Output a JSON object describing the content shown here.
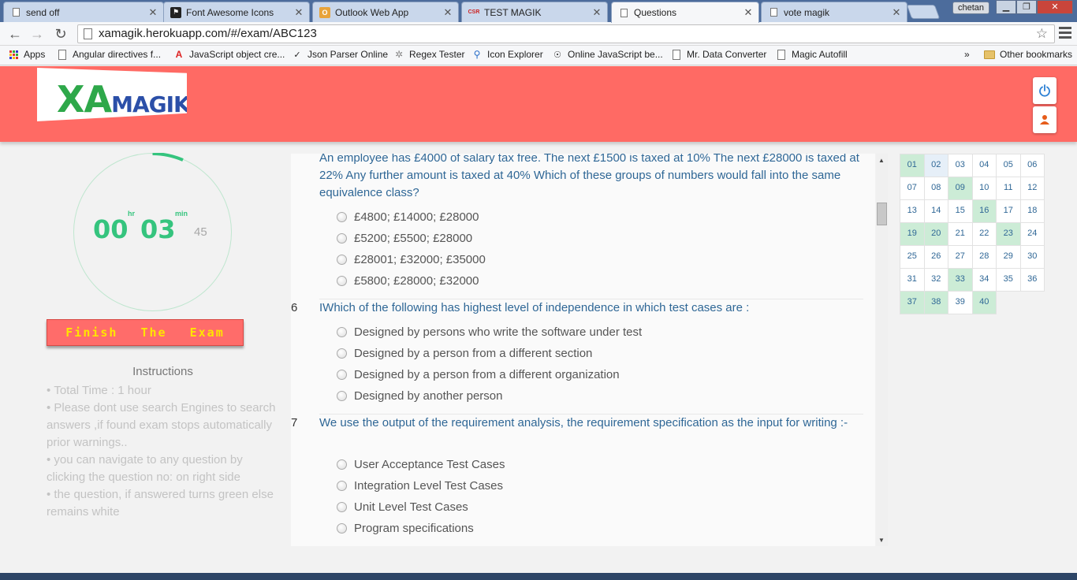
{
  "browser": {
    "tabs": [
      {
        "title": "send off",
        "active": false
      },
      {
        "title": "Font Awesome Icons",
        "active": false
      },
      {
        "title": "Outlook Web App",
        "active": false
      },
      {
        "title": "TEST MAGIK",
        "active": false
      },
      {
        "title": "Questions",
        "active": true
      },
      {
        "title": "vote magik",
        "active": false
      }
    ],
    "user": "chetan",
    "url": "xamagik.herokuapp.com/#/exam/ABC123",
    "bookmarks": [
      {
        "label": "Apps"
      },
      {
        "label": "Angular directives f..."
      },
      {
        "label": "JavaScript object cre..."
      },
      {
        "label": "Json Parser Online"
      },
      {
        "label": "Regex Tester"
      },
      {
        "label": "Icon Explorer"
      },
      {
        "label": "Online JavaScript be..."
      },
      {
        "label": "Mr. Data Converter"
      },
      {
        "label": "Magic Autofill"
      }
    ],
    "overflow": "»",
    "other_bookmarks": "Other bookmarks"
  },
  "header": {
    "logo_x": "X",
    "logo_a": "A",
    "logo_m": "MAGIK",
    "brand_color": "#ff6a64"
  },
  "timer": {
    "hours": "00",
    "minutes": "03",
    "seconds": "45",
    "hr_label": "hr",
    "min_label": "min"
  },
  "finish_label": "Finish The Exam",
  "instructions": {
    "title": "Instructions",
    "items": [
      "Total Time : 1 hour",
      "Please dont use search Engines to search answers ,if found exam stops automatically prior warnings..",
      "you can navigate to any question by clicking the question no: on right side",
      "the question, if answered turns green else remains white"
    ]
  },
  "questions": [
    {
      "number": "",
      "text": "An employee has £4000 of salary tax free. The next £1500 is taxed at 10% The next £28000 is taxed at 22% Any further amount is taxed at 40% Which of these groups of numbers would fall into the same equivalence class?",
      "options": [
        "£4800; £14000; £28000",
        "£5200; £5500; £28000",
        "£28001; £32000; £35000",
        "£5800; £28000; £32000"
      ]
    },
    {
      "number": "6",
      "text": "IWhich of the following has highest level of independence in which test cases are :",
      "options": [
        "Designed by persons who write the software under test",
        "Designed by a person from a different section",
        "Designed by a person from a different organization",
        "Designed by another person"
      ]
    },
    {
      "number": "7",
      "text": "We use the output of the requirement analysis, the requirement specification as the input for writing :-",
      "options": [
        "User Acceptance Test Cases",
        "Integration Level Test Cases",
        "Unit Level Test Cases",
        "Program specifications"
      ]
    }
  ],
  "question_grid": {
    "numbers": [
      "01",
      "02",
      "03",
      "04",
      "05",
      "06",
      "07",
      "08",
      "09",
      "10",
      "11",
      "12",
      "13",
      "14",
      "15",
      "16",
      "17",
      "18",
      "19",
      "20",
      "21",
      "22",
      "23",
      "24",
      "25",
      "26",
      "27",
      "28",
      "29",
      "30",
      "31",
      "32",
      "33",
      "34",
      "35",
      "36",
      "37",
      "38",
      "39",
      "40"
    ],
    "answered": [
      "01",
      "09",
      "16",
      "19",
      "20",
      "23",
      "33",
      "37",
      "38",
      "40"
    ],
    "current": "02",
    "answered_color": "#ccecd6"
  }
}
